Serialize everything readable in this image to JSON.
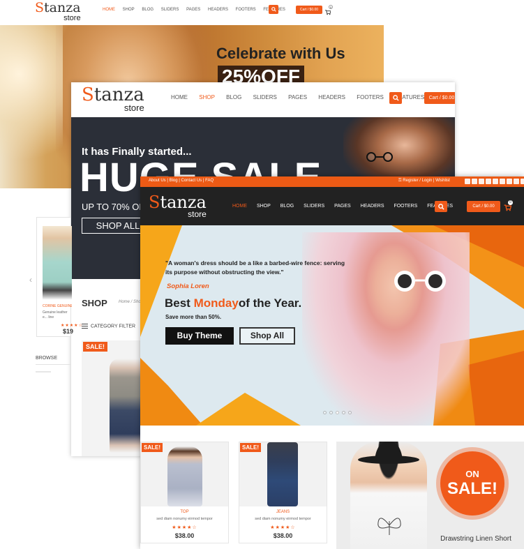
{
  "screen1": {
    "logo_main": "Stanza",
    "logo_sub": "store",
    "nav": [
      "HOME",
      "SHOP",
      "BLOG",
      "SLIDERS",
      "PAGES",
      "HEADERS",
      "FOOTERS",
      "FEATURES"
    ],
    "cart_label": "Cart / $0.00",
    "cart_count": "0",
    "hero_line1": "Celebrate with Us",
    "hero_line2": "25%OFF"
  },
  "screen2": {
    "logo_main": "Stanza",
    "logo_sub": "store",
    "nav": [
      "HOME",
      "SHOP",
      "BLOG",
      "SLIDERS",
      "PAGES",
      "HEADERS",
      "FOOTERS",
      "FEATURES"
    ],
    "cart_label": "Cart / $0.00",
    "hero_kicker": "It has Finally started...",
    "hero_headline": "HUGE SALE",
    "hero_sub": "UP TO 70% OFF",
    "hero_button": "SHOP ALL",
    "shop_title": "SHOP",
    "breadcrumb": "Home / Shop",
    "category_filter": "CATEGORY FILTER",
    "sale_badge": "SALE!",
    "browse_title": "BROWSE",
    "side_product_category": "CORINE GENUINE LEATHER",
    "side_product_desc": "Genuine leather e... line",
    "side_product_price": "$19",
    "side_product_rating": 4
  },
  "screen3": {
    "topbar_links": [
      "About Us",
      "Blog",
      "Contact Us",
      "FAQ"
    ],
    "topbar_account": "Register / Login",
    "topbar_wishlist": "Wishlist",
    "logo_main": "Stanza",
    "logo_sub": "store",
    "nav": [
      "HOME",
      "SHOP",
      "BLOG",
      "SLIDERS",
      "PAGES",
      "HEADERS",
      "FOOTERS",
      "FEATURES"
    ],
    "cart_label": "Cart / $0.00",
    "cart_count": "0",
    "hero_quote": "\"A woman's dress should be a like a barbed-wire fence: serving its purpose without obstructing the view.\"",
    "hero_author": "Sophia Loren",
    "hero_headline_pre": "Best ",
    "hero_headline_accent": "Monday",
    "hero_headline_post": "of the Year.",
    "hero_sub": "Save more than 50%.",
    "btn_buy": "Buy Theme",
    "btn_shop": "Shop All",
    "slider_active_dot": 2,
    "slider_dot_count": 5,
    "products": [
      {
        "badge": "SALE!",
        "category": "TOP",
        "desc": "sed diam nonumy eirmod tempor",
        "price": "$38.00",
        "rating": 4
      },
      {
        "badge": "SALE!",
        "category": "JEANS",
        "desc": "sed diam nonumy eirmod tempor",
        "price": "$38.00",
        "rating": 4
      }
    ],
    "promo_circle_line1": "ON",
    "promo_circle_line2": "SALE!",
    "promo_caption": "Drawstring Linen Short"
  },
  "colors": {
    "accent": "#f05a1a",
    "dark_bar": "#222222",
    "slate_hero": "#2b2f38"
  }
}
